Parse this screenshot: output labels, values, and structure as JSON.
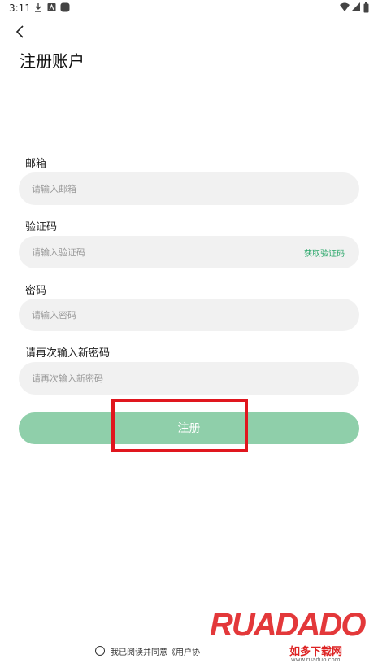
{
  "status_bar": {
    "time": "3:11"
  },
  "header": {
    "title": "注册账户"
  },
  "form": {
    "email": {
      "label": "邮箱",
      "placeholder": "请输入邮箱"
    },
    "code": {
      "label": "验证码",
      "placeholder": "请输入验证码",
      "action": "获取验证码"
    },
    "password": {
      "label": "密码",
      "placeholder": "请输入密码"
    },
    "confirm_password": {
      "label": "请再次输入新密码",
      "placeholder": "请再次输入新密码"
    },
    "submit": "注册"
  },
  "agreement": {
    "text": "我已阅读并同意《用户协"
  },
  "watermark": {
    "logo": "RUADADO",
    "cn": "如多下载网",
    "url": "www.ruaduo.com"
  },
  "colors": {
    "accent": "#2aa76a",
    "button": "#8fcfaa",
    "highlight": "#e0161e",
    "field_bg": "#f1f1f1"
  }
}
